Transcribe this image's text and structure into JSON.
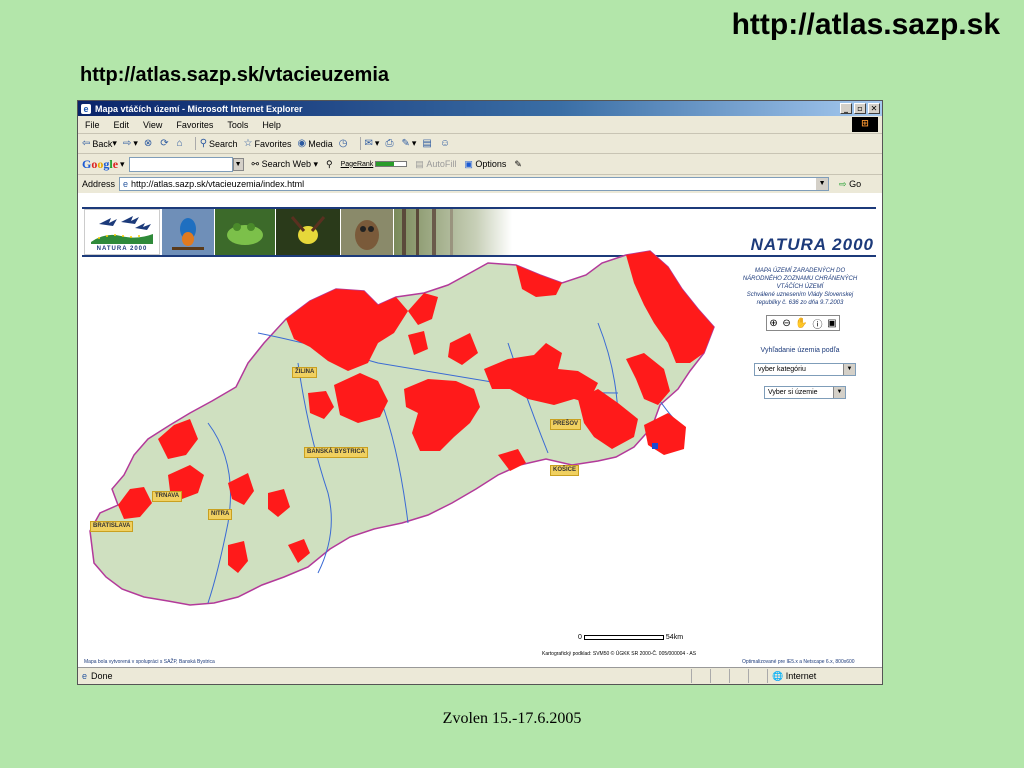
{
  "slide": {
    "title": "http://atlas.sazp.sk",
    "subtitle": "http://atlas.sazp.sk/vtacieuzemia",
    "footer": "Zvolen 15.-17.6.2005"
  },
  "window": {
    "title": "Mapa vtáčích území - Microsoft Internet Explorer",
    "minimize": "_",
    "maximize": "▫",
    "close": "✕"
  },
  "menu": [
    "File",
    "Edit",
    "View",
    "Favorites",
    "Tools",
    "Help"
  ],
  "toolbar": {
    "back": "Back",
    "search": "Search",
    "favorites": "Favorites",
    "media": "Media"
  },
  "googlebar": {
    "search_web": "Search Web",
    "pagerank": "PageRank",
    "autofill": "AutoFill",
    "options": "Options"
  },
  "address": {
    "label": "Address",
    "url": "http://atlas.sazp.sk/vtacieuzemia/index.html",
    "go": "Go"
  },
  "page": {
    "logo_caption": "NATURA 2000",
    "banner_title": "NATURA 2000",
    "info_lines": [
      "MAPA ÚZEMÍ ZARADENÝCH DO",
      "NÁRODNÉHO ZOZNAMU CHRÁNENÝCH",
      "VTÁČÍCH ÚZEMÍ",
      "Schválené uznesením Vlády Slovenskej",
      "republiky č. 636 zo dňa 9.7.2003"
    ],
    "search_label": "Vyhľadanie územia podľa",
    "select_category": "vyber kategóriu",
    "select_area": "Vyber si územie",
    "scale_start": "0",
    "scale_end": "54km",
    "footer_left": "Mapa bola vytvorená v spolupráci s SAŽP, Banská Bystrica",
    "footer_right": "Optimalizované pre IE5.x a Netscape 6.x, 800x600",
    "credit": "Kartografický podklad: SVM50 © ÚGKK SR 2000-Č. 005/000004 - AS"
  },
  "cities": {
    "zilina": "ŽILINA",
    "banska": "BANSKÁ BYSTRICA",
    "presov": "PREŠOV",
    "kosice": "KOŠICE",
    "trnava": "TRNAVA",
    "nitra": "NITRA",
    "bratislava": "BRATISLAVA"
  },
  "status": {
    "text": "Done",
    "zone": "Internet"
  },
  "colors": {
    "slide_bg": "#b3e6aa",
    "protected_area": "#ff1a1a",
    "natura_blue": "#1c3a7a"
  }
}
